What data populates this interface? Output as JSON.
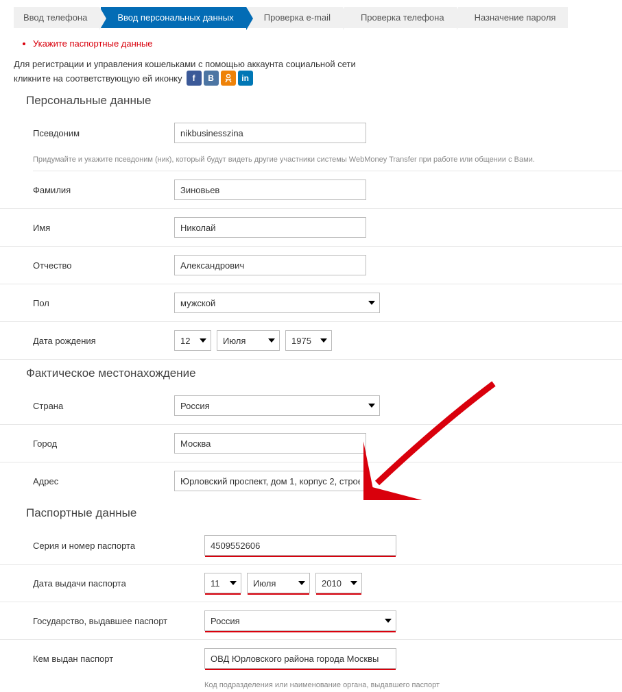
{
  "wizard": {
    "steps": [
      "Ввод телефона",
      "Ввод персональных данных",
      "Проверка e-mail",
      "Проверка телефона",
      "Назначение пароля"
    ],
    "active_index": 1
  },
  "error": "Укажите паспортные данные",
  "social": {
    "line1": "Для регистрации и управления кошельками с помощью аккаунта социальной сети",
    "line2": "кликните на соответствующую ей иконку"
  },
  "sections": {
    "personal": "Персональные данные",
    "location": "Фактическое местонахождение",
    "passport": "Паспортные данные"
  },
  "personal": {
    "nickname": {
      "label": "Псевдоним",
      "value": "nikbusinesszina"
    },
    "nickname_hint": "Придумайте и укажите псевдоним (ник), который будут видеть другие участники системы WebMoney Transfer при работе или общении с Вами.",
    "lastname": {
      "label": "Фамилия",
      "value": "Зиновьев"
    },
    "firstname": {
      "label": "Имя",
      "value": "Николай"
    },
    "middlename": {
      "label": "Отчество",
      "value": "Александрович"
    },
    "gender": {
      "label": "Пол",
      "value": "мужской"
    },
    "birthdate": {
      "label": "Дата рождения",
      "day": "12",
      "month": "Июля",
      "year": "1975"
    }
  },
  "location": {
    "country": {
      "label": "Страна",
      "value": "Россия"
    },
    "city": {
      "label": "Город",
      "value": "Москва"
    },
    "address": {
      "label": "Адрес",
      "value": "Юрловский проспект, дом 1, корпус 2, строе"
    }
  },
  "passport": {
    "number": {
      "label": "Серия и номер паспорта",
      "value": "4509552606"
    },
    "issue_date": {
      "label": "Дата выдачи паспорта",
      "day": "11",
      "month": "Июля",
      "year": "2010"
    },
    "country": {
      "label": "Государство, выдавшее паспорт",
      "value": "Россия"
    },
    "issued_by": {
      "label": "Кем выдан паспорт",
      "value": "ОВД Юрловского района города Москвы"
    },
    "issued_hint": "Код подразделения или наименование органа, выдавшего паспорт"
  }
}
